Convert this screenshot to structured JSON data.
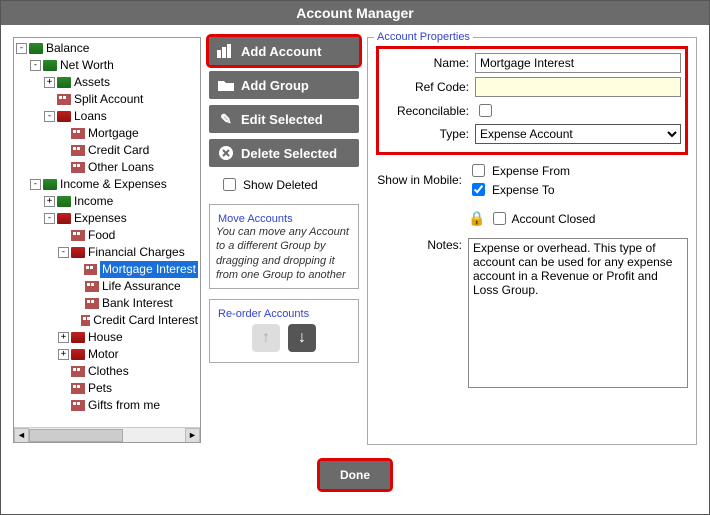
{
  "title": "Account Manager",
  "tree": {
    "root": "Balance",
    "netWorth": "Net Worth",
    "assets": "Assets",
    "splitAccount": "Split Account",
    "loans": "Loans",
    "mortgage": "Mortgage",
    "creditCard": "Credit Card",
    "otherLoans": "Other Loans",
    "incExp": "Income & Expenses",
    "income": "Income",
    "expenses": "Expenses",
    "food": "Food",
    "finCharges": "Financial Charges",
    "mortInt": "Mortgage Interest",
    "lifeAssur": "Life Assurance",
    "bankInt": "Bank Interest",
    "ccInt": "Credit Card Interest",
    "house": "House",
    "motor": "Motor",
    "clothes": "Clothes",
    "pets": "Pets",
    "gifts": "Gifts from me"
  },
  "buttons": {
    "addAccount": "Add Account",
    "addGroup": "Add Group",
    "editSelected": "Edit Selected",
    "deleteSelected": "Delete Selected",
    "showDeleted": "Show Deleted",
    "done": "Done"
  },
  "move": {
    "title": "Move Accounts",
    "text": "You can move any Account to a different Group by dragging and dropping it from one Group to another"
  },
  "reorder": {
    "title": "Re-order Accounts"
  },
  "props": {
    "title": "Account Properties",
    "nameLabel": "Name:",
    "nameValue": "Mortgage Interest",
    "refLabel": "Ref Code:",
    "refValue": "",
    "reconLabel": "Reconcilable:",
    "typeLabel": "Type:",
    "typeValue": "Expense Account",
    "mobileLabel": "Show in Mobile:",
    "expFrom": "Expense From",
    "expTo": "Expense To",
    "closedLabel": "Account Closed",
    "notesLabel": "Notes:",
    "notesValue": "Expense or overhead. This type of account can be used for any expense account in a Revenue or Profit and Loss Group."
  }
}
